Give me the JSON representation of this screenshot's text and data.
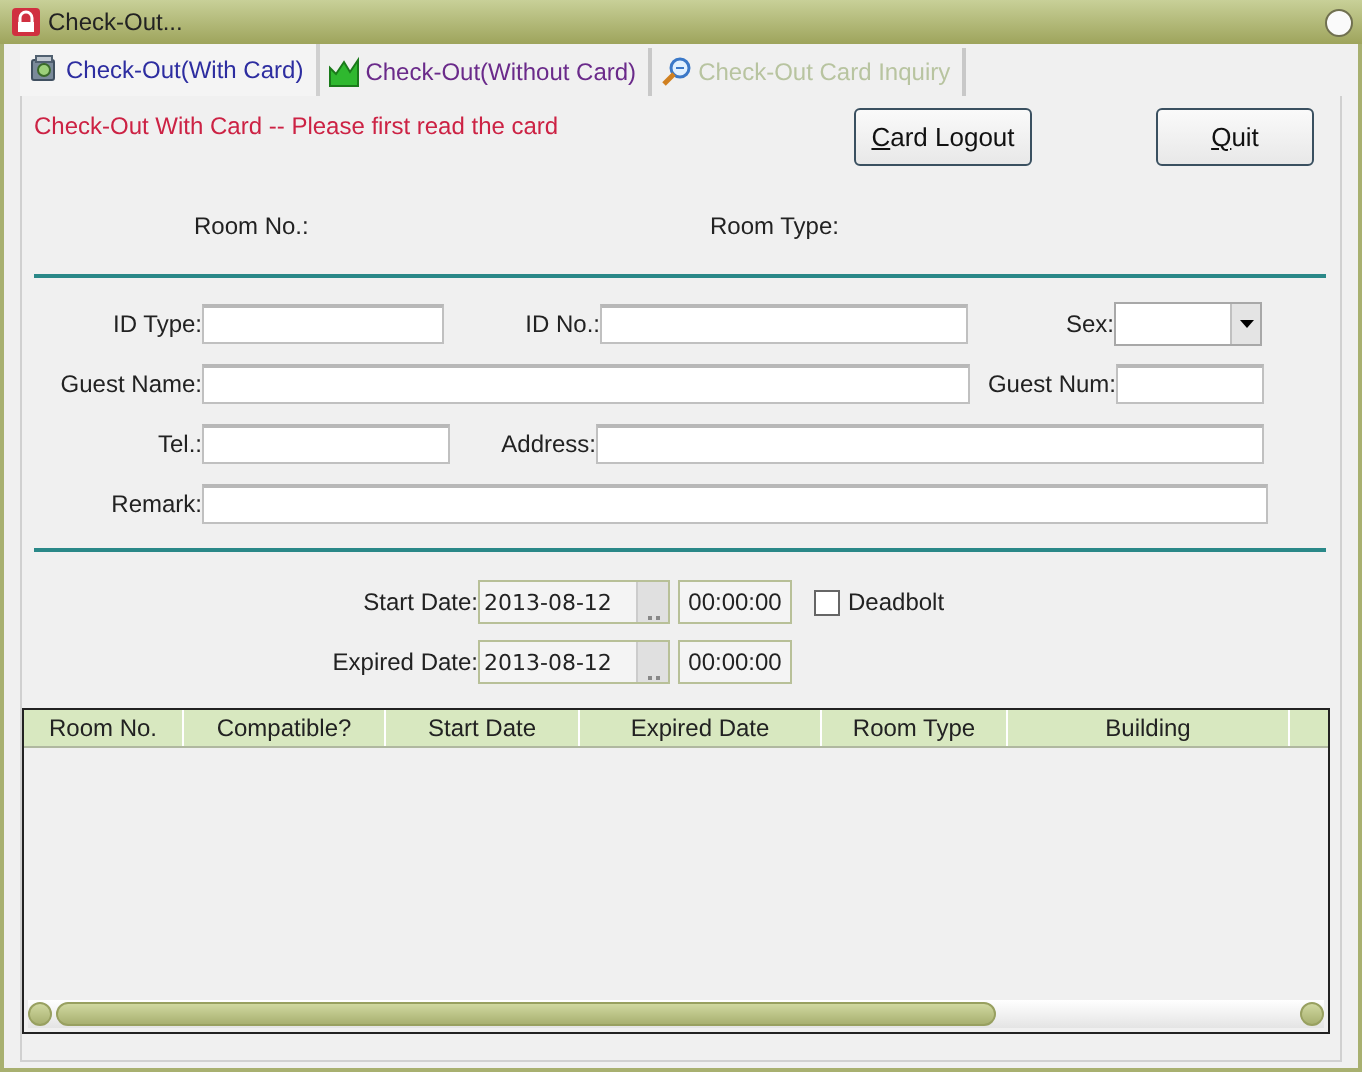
{
  "window": {
    "title": "Check-Out..."
  },
  "tabs": [
    {
      "label": "Check-Out(With Card)",
      "selected": true,
      "disabled": false
    },
    {
      "label": "Check-Out(Without Card)",
      "selected": false,
      "disabled": false
    },
    {
      "label": "Check-Out Card Inquiry",
      "selected": false,
      "disabled": true
    }
  ],
  "message": "Check-Out With Card -- Please first read the card",
  "buttons": [
    "Card Logout",
    "Quit"
  ],
  "room_info": [
    "Room No.:",
    "Room Type:"
  ],
  "field_rows": [
    [
      {
        "label": "ID Type:",
        "kind": "text"
      },
      {
        "label": "ID No.:",
        "kind": "text"
      },
      {
        "label": "Sex:",
        "kind": "select"
      }
    ],
    [
      {
        "label": "Guest Name:",
        "kind": "text"
      },
      {
        "label": "Guest Num:",
        "kind": "text"
      }
    ],
    [
      {
        "label": "Tel.:",
        "kind": "text"
      },
      {
        "label": "Address:",
        "kind": "text"
      }
    ],
    [
      {
        "label": "Remark:",
        "kind": "text"
      }
    ]
  ],
  "dates": [
    {
      "label": "Start Date:",
      "date": "2013-08-12",
      "time": "00:00:00"
    },
    {
      "label": "Expired Date:",
      "date": "2013-08-12",
      "time": "00:00:00"
    }
  ],
  "deadbolt": {
    "label": "Deadbolt",
    "checked": false
  },
  "table": {
    "columns": [
      "Room No.",
      "Compatible?",
      "Start Date",
      "Expired Date",
      "Room Type",
      "Building"
    ]
  }
}
